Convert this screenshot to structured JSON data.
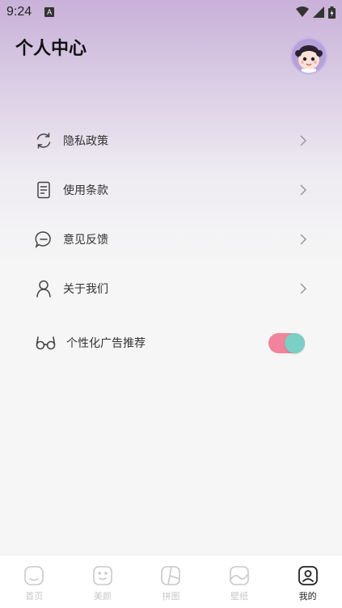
{
  "status_bar": {
    "time": "9:24",
    "notification_icon": "A"
  },
  "header": {
    "title": "个人中心"
  },
  "menu": {
    "items": [
      {
        "label": "隐私政策",
        "icon": "refresh-icon"
      },
      {
        "label": "使用条款",
        "icon": "document-icon"
      },
      {
        "label": "意见反馈",
        "icon": "chat-icon"
      },
      {
        "label": "关于我们",
        "icon": "user-icon"
      }
    ],
    "ad_toggle": {
      "label": "个性化广告推荐",
      "icon": "glasses-icon",
      "enabled": true
    }
  },
  "bottom_nav": {
    "items": [
      {
        "label": "首页",
        "active": false
      },
      {
        "label": "美颜",
        "active": false
      },
      {
        "label": "拼图",
        "active": false
      },
      {
        "label": "壁纸",
        "active": false
      },
      {
        "label": "我的",
        "active": true
      }
    ]
  },
  "colors": {
    "toggle_track": "#f1849c",
    "toggle_knob": "#7bcfc4",
    "header_gradient_top": "#c9b1d9"
  }
}
